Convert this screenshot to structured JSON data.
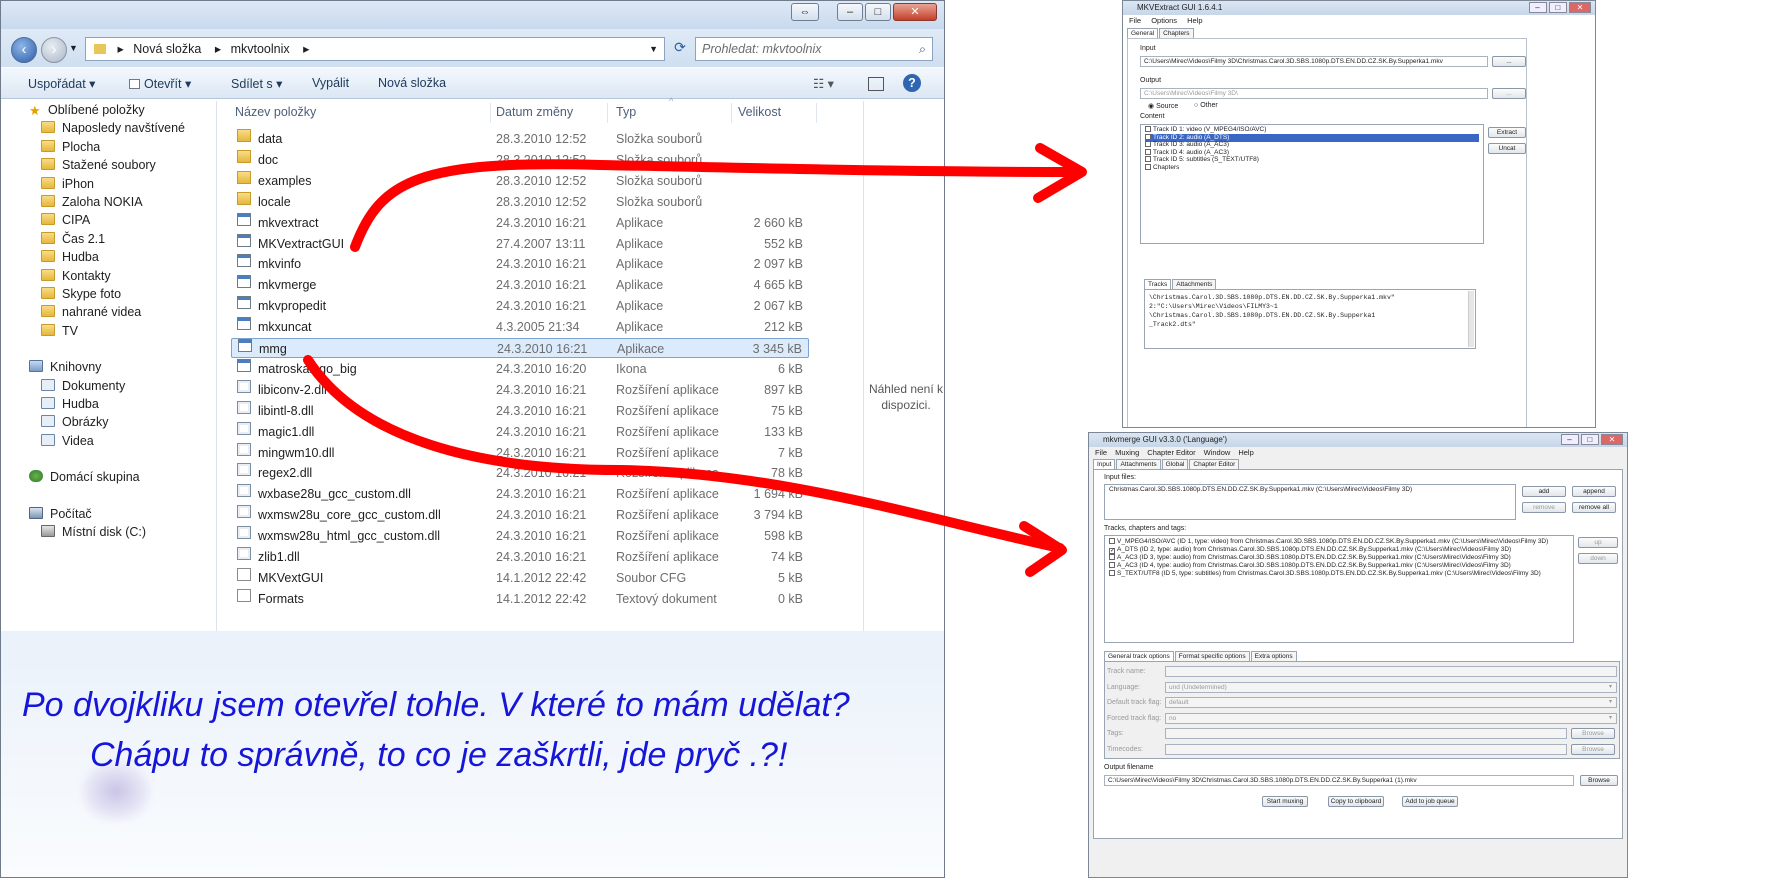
{
  "explorer": {
    "breadcrumb": [
      "Nová složka",
      "mkvtoolnix"
    ],
    "search_placeholder": "Prohledat: mkvtoolnix",
    "toolbar": {
      "organize": "Uspořádat",
      "open": "Otevřít",
      "share": "Sdílet s",
      "burn": "Vypálit",
      "new_folder": "Nová složka"
    },
    "nav": {
      "favorites": "Oblíbené položky",
      "fav_items": [
        "Naposledy navštívené",
        "Plocha",
        "Stažené soubory",
        "iPhon",
        "Zaloha NOKIA",
        "CIPA",
        "Čas 2.1",
        "Hudba",
        "Kontakty",
        "Skype foto",
        "nahrané videa",
        "TV"
      ],
      "libraries": "Knihovny",
      "lib_items": [
        "Dokumenty",
        "Hudba",
        "Obrázky",
        "Videa"
      ],
      "homegroup": "Domácí skupina",
      "computer": "Počítač",
      "comp_items": [
        "Místní disk (C:)"
      ]
    },
    "columns": {
      "name": "Název položky",
      "date": "Datum změny",
      "type": "Typ",
      "size": "Velikost"
    },
    "files": [
      {
        "name": "data",
        "date": "28.3.2010 12:52",
        "type": "Složka souborů",
        "size": "",
        "icon": "folder"
      },
      {
        "name": "doc",
        "date": "28.3.2010 12:52",
        "type": "Složka souborů",
        "size": "",
        "icon": "folder"
      },
      {
        "name": "examples",
        "date": "28.3.2010 12:52",
        "type": "Složka souborů",
        "size": "",
        "icon": "folder"
      },
      {
        "name": "locale",
        "date": "28.3.2010 12:52",
        "type": "Složka souborů",
        "size": "",
        "icon": "folder"
      },
      {
        "name": "mkvextract",
        "date": "24.3.2010 16:21",
        "type": "Aplikace",
        "size": "2 660 kB",
        "icon": "app"
      },
      {
        "name": "MKVextractGUI",
        "date": "27.4.2007 13:11",
        "type": "Aplikace",
        "size": "552 kB",
        "icon": "app"
      },
      {
        "name": "mkvinfo",
        "date": "24.3.2010 16:21",
        "type": "Aplikace",
        "size": "2 097 kB",
        "icon": "app"
      },
      {
        "name": "mkvmerge",
        "date": "24.3.2010 16:21",
        "type": "Aplikace",
        "size": "4 665 kB",
        "icon": "app"
      },
      {
        "name": "mkvpropedit",
        "date": "24.3.2010 16:21",
        "type": "Aplikace",
        "size": "2 067 kB",
        "icon": "app"
      },
      {
        "name": "mkxuncat",
        "date": "4.3.2005 21:34",
        "type": "Aplikace",
        "size": "212 kB",
        "icon": "app"
      },
      {
        "name": "mmg",
        "date": "24.3.2010 16:21",
        "type": "Aplikace",
        "size": "3 345 kB",
        "icon": "app",
        "selected": true
      },
      {
        "name": "matroskalogo_big",
        "date": "24.3.2010 16:20",
        "type": "Ikona",
        "size": "6 kB",
        "icon": "app"
      },
      {
        "name": "libiconv-2.dll",
        "date": "24.3.2010 16:21",
        "type": "Rozšíření aplikace",
        "size": "897 kB",
        "icon": "dll"
      },
      {
        "name": "libintl-8.dll",
        "date": "24.3.2010 16:21",
        "type": "Rozšíření aplikace",
        "size": "75 kB",
        "icon": "dll"
      },
      {
        "name": "magic1.dll",
        "date": "24.3.2010 16:21",
        "type": "Rozšíření aplikace",
        "size": "133 kB",
        "icon": "dll"
      },
      {
        "name": "mingwm10.dll",
        "date": "24.3.2010 16:21",
        "type": "Rozšíření aplikace",
        "size": "7 kB",
        "icon": "dll"
      },
      {
        "name": "regex2.dll",
        "date": "24.3.2010 16:21",
        "type": "Rozšíření aplikace",
        "size": "78 kB",
        "icon": "dll"
      },
      {
        "name": "wxbase28u_gcc_custom.dll",
        "date": "24.3.2010 16:21",
        "type": "Rozšíření aplikace",
        "size": "1 694 kB",
        "icon": "dll"
      },
      {
        "name": "wxmsw28u_core_gcc_custom.dll",
        "date": "24.3.2010 16:21",
        "type": "Rozšíření aplikace",
        "size": "3 794 kB",
        "icon": "dll"
      },
      {
        "name": "wxmsw28u_html_gcc_custom.dll",
        "date": "24.3.2010 16:21",
        "type": "Rozšíření aplikace",
        "size": "598 kB",
        "icon": "dll"
      },
      {
        "name": "zlib1.dll",
        "date": "24.3.2010 16:21",
        "type": "Rozšíření aplikace",
        "size": "74 kB",
        "icon": "dll"
      },
      {
        "name": "MKVextGUI",
        "date": "14.1.2012 22:42",
        "type": "Soubor CFG",
        "size": "5 kB",
        "icon": "doc"
      },
      {
        "name": "Formats",
        "date": "14.1.2012 22:42",
        "type": "Textový dokument",
        "size": "0 kB",
        "icon": "doc"
      }
    ],
    "preview_text": "Náhled není k dispozici."
  },
  "annotation": {
    "line1": "Po dvojkliku jsem otevřel tohle. V které to mám udělat?",
    "line2": "Chápu to správně, to co je zaškrtli, jde pryč .?!",
    "color": "#1616d8"
  },
  "arrow_color": "#ff0000",
  "mkvextract": {
    "title": "MKVExtract GUI 1.6.4.1",
    "menu": [
      "File",
      "Options",
      "Help"
    ],
    "tabs": [
      "General",
      "Chapters"
    ],
    "input_label": "Input",
    "input_value": "C:\\Users\\Mirec\\Videos\\Filmy 3D\\Christmas.Carol.3D.SBS.1080p.DTS.EN.DD.CZ.SK.By.Supperka1.mkv",
    "browse": "...",
    "output_label": "Output",
    "output_value": "C:\\Users\\Mirec\\Videos\\Filmy 3D\\",
    "radio_source": "Source",
    "radio_other": "Other",
    "content_label": "Content",
    "tracks": [
      "Track ID 1: video (V_MPEG4/ISO/AVC)",
      "Track ID 2: audio (A_DTS)",
      "Track ID 3: audio (A_AC3)",
      "Track ID 4: audio (A_AC3)",
      "Track ID 5: subtitles (S_TEXT/UTF8)",
      "Chapters"
    ],
    "extract": "Extract",
    "uncat": "Uncat",
    "bottom_tabs": [
      "Tracks",
      "Attachments"
    ],
    "cmd_lines": [
      "\\Christmas.Carol.3D.SBS.1080p.DTS.EN.DD.CZ.SK.By.Supperka1.mkv\"",
      "2:\"C:\\Users\\Mirec\\Videos\\FILMY3~1",
      "\\Christmas.Carol.3D.SBS.1080p.DTS.EN.DD.CZ.SK.By.Supperka1",
      "_Track2.dts\""
    ]
  },
  "mmg": {
    "title": "mkvmerge GUI v3.3.0 ('Language')",
    "menu": [
      "File",
      "Muxing",
      "Chapter Editor",
      "Window",
      "Help"
    ],
    "tabs": [
      "Input",
      "Attachments",
      "Global",
      "Chapter Editor"
    ],
    "input_files_label": "Input files:",
    "input_file": "Christmas.Carol.3D.SBS.1080p.DTS.EN.DD.CZ.SK.By.Supperka1.mkv (C:\\Users\\Mirec\\Videos\\Filmy 3D)",
    "add": "add",
    "append": "append",
    "remove": "remove",
    "remove_all": "remove all",
    "tracks_label": "Tracks, chapters and tags:",
    "tracks": [
      "V_MPEG4/ISO/AVC (ID 1, type: video) from Christmas.Carol.3D.SBS.1080p.DTS.EN.DD.CZ.SK.By.Supperka1.mkv (C:\\Users\\Mirec\\Videos\\Filmy 3D)",
      "A_DTS (ID 2, type: audio) from Christmas.Carol.3D.SBS.1080p.DTS.EN.DD.CZ.SK.By.Supperka1.mkv (C:\\Users\\Mirec\\Videos\\Filmy 3D)",
      "A_AC3 (ID 3, type: audio) from Christmas.Carol.3D.SBS.1080p.DTS.EN.DD.CZ.SK.By.Supperka1.mkv (C:\\Users\\Mirec\\Videos\\Filmy 3D)",
      "A_AC3 (ID 4, type: audio) from Christmas.Carol.3D.SBS.1080p.DTS.EN.DD.CZ.SK.By.Supperka1.mkv (C:\\Users\\Mirec\\Videos\\Filmy 3D)",
      "S_TEXT/UTF8 (ID 5, type: subtitles) from Christmas.Carol.3D.SBS.1080p.DTS.EN.DD.CZ.SK.By.Supperka1.mkv (C:\\Users\\Mirec\\Videos\\Filmy 3D)"
    ],
    "up": "up",
    "down": "down",
    "opt_tabs": [
      "General track options",
      "Format specific options",
      "Extra options"
    ],
    "fields": [
      {
        "label": "Track name:",
        "value": ""
      },
      {
        "label": "Language:",
        "value": "und (Undetermined)"
      },
      {
        "label": "Default track flag:",
        "value": "default"
      },
      {
        "label": "Forced track flag:",
        "value": "no"
      },
      {
        "label": "Tags:",
        "value": ""
      },
      {
        "label": "Timecodes:",
        "value": ""
      }
    ],
    "browse": "Browse",
    "output_label": "Output filename",
    "output_value": "C:\\Users\\Mirec\\Videos\\Filmy 3D\\Christmas.Carol.3D.SBS.1080p.DTS.EN.DD.CZ.SK.By.Supperka1 (1).mkv",
    "start": "Start muxing",
    "copy": "Copy to clipboard",
    "job": "Add to job queue"
  }
}
